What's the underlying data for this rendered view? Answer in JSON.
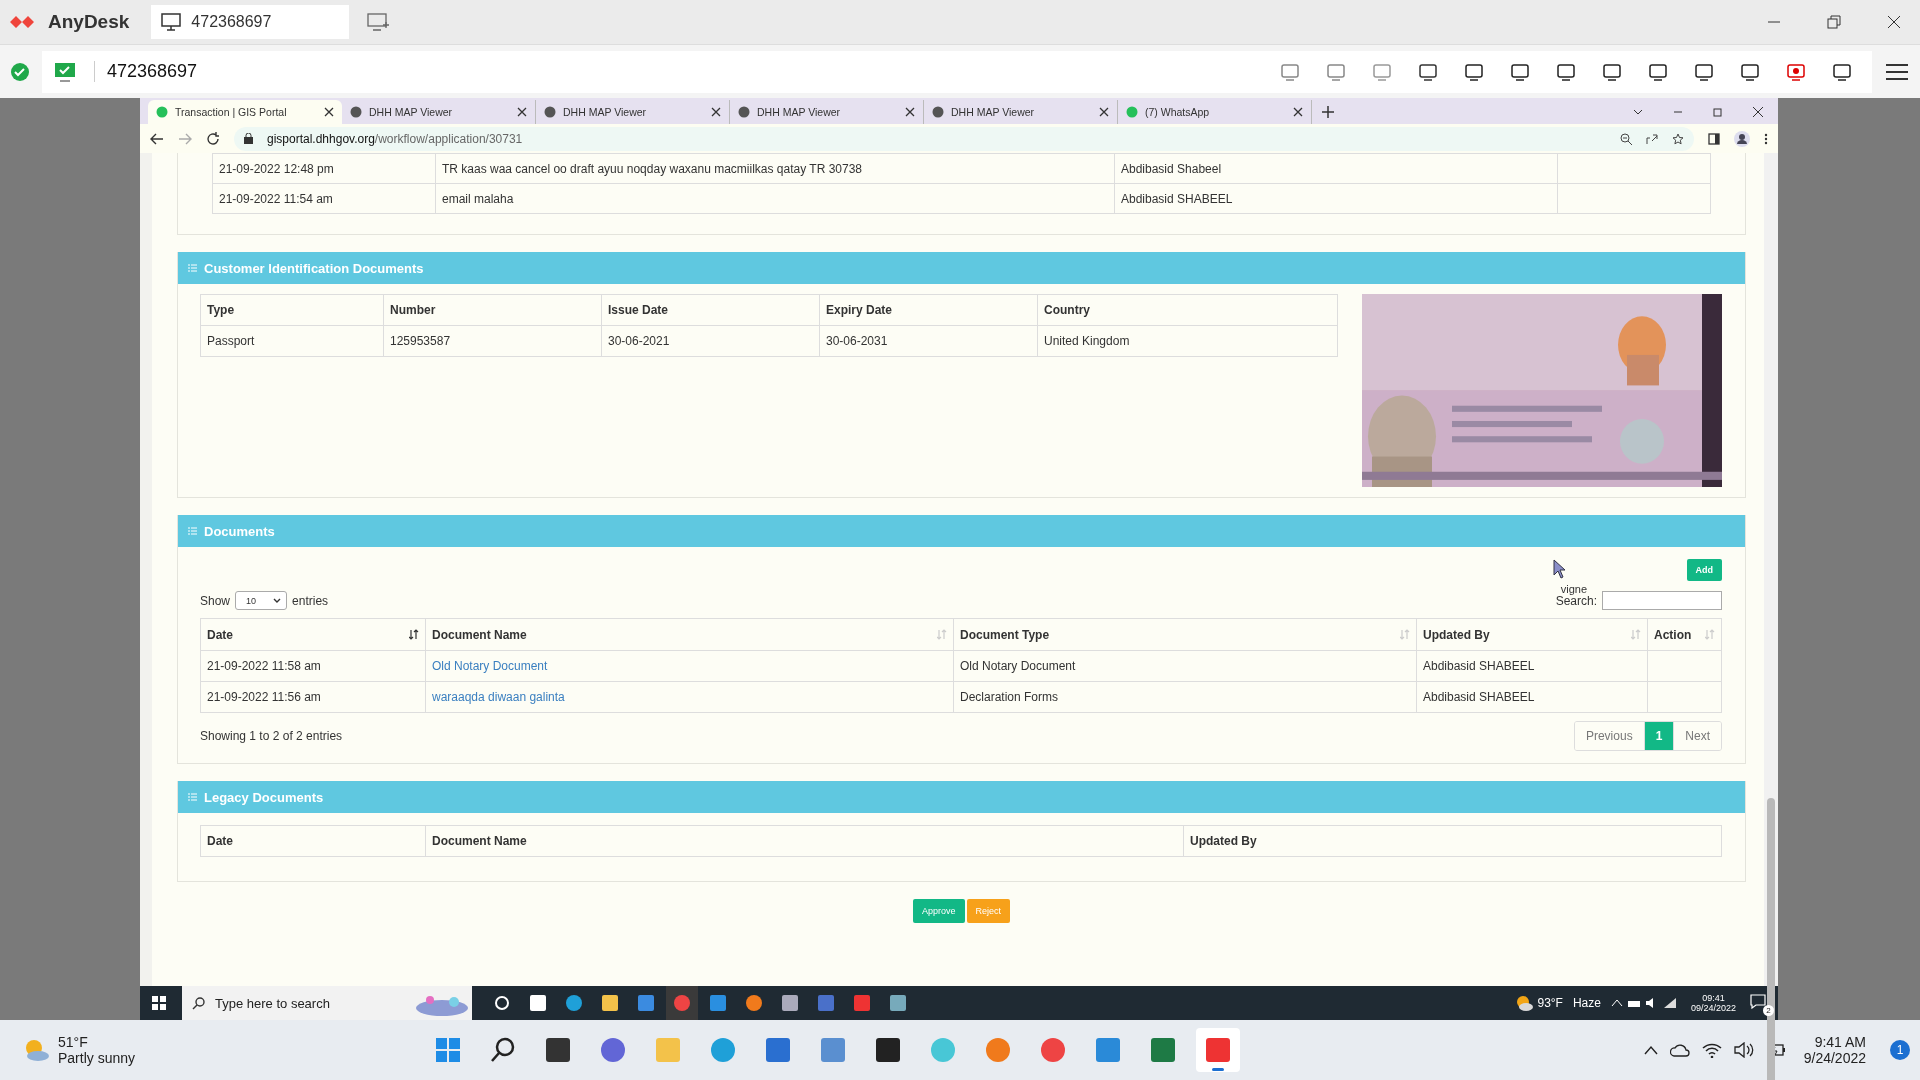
{
  "anydesk": {
    "app_name": "AnyDesk",
    "address": "472368697",
    "session_id": "472368697"
  },
  "browser": {
    "tabs": [
      {
        "title": "Transaction | GIS Portal",
        "selected": true,
        "kind": "portal"
      },
      {
        "title": "DHH MAP Viewer",
        "selected": false,
        "kind": "globe"
      },
      {
        "title": "DHH MAP Viewer",
        "selected": false,
        "kind": "globe"
      },
      {
        "title": "DHH MAP Viewer",
        "selected": false,
        "kind": "globe"
      },
      {
        "title": "DHH MAP Viewer",
        "selected": false,
        "kind": "globe"
      },
      {
        "title": "(7) WhatsApp",
        "selected": false,
        "kind": "whatsapp"
      }
    ],
    "url_host": "gisportal.dhhgov.org",
    "url_path": "/workflow/application/30731"
  },
  "history_rows": [
    {
      "date": "21-09-2022 12:48 pm",
      "comment": "TR kaas waa cancel oo draft ayuu noqday waxanu macmiilkas qatay TR 30738",
      "user": "Abdibasid Shabeel"
    },
    {
      "date": "21-09-2022 11:54 am",
      "comment": "email malaha",
      "user": "Abdibasid SHABEEL"
    }
  ],
  "customer_docs": {
    "title": "Customer Identification Documents",
    "columns": [
      "Type",
      "Number",
      "Issue Date",
      "Expiry Date",
      "Country"
    ],
    "rows": [
      [
        "Passport",
        "125953587",
        "30-06-2021",
        "30-06-2031",
        "United Kingdom"
      ]
    ]
  },
  "documents": {
    "title": "Documents",
    "add_button": "Add",
    "cursor_label": "vigne",
    "show_label": "Show",
    "entries_value": "10",
    "entries_label": "entries",
    "search_label": "Search:",
    "columns": [
      {
        "label": "Date",
        "sorted": true
      },
      {
        "label": "Document Name",
        "sorted": false
      },
      {
        "label": "Document Type",
        "sorted": false
      },
      {
        "label": "Updated By",
        "sorted": false
      },
      {
        "label": "Action",
        "sorted": false
      }
    ],
    "rows": [
      {
        "date": "21-09-2022 11:58 am",
        "name": "Old Notary Document",
        "type": "Old Notary Document",
        "user": "Abdibasid SHABEEL"
      },
      {
        "date": "21-09-2022 11:56 am",
        "name": "waraaqda diwaan galinta",
        "type": "Declaration Forms",
        "user": "Abdibasid SHABEEL"
      }
    ],
    "info": "Showing 1 to 2 of 2 entries",
    "pagination": [
      {
        "label": "Previous",
        "selected": false
      },
      {
        "label": "1",
        "selected": true
      },
      {
        "label": "Next",
        "selected": false
      }
    ]
  },
  "legacy": {
    "title": "Legacy Documents",
    "columns": [
      "Date",
      "Document Name",
      "Updated By"
    ]
  },
  "actions": [
    {
      "label": "Approve",
      "kind": "approve"
    },
    {
      "label": "Reject",
      "kind": "reject"
    }
  ],
  "remote_taskbar": {
    "placeholder": "Type here to search",
    "temperature": "93°F",
    "weather": "Haze",
    "time": "09:41",
    "date": "09/24/2022",
    "notification_count": "2"
  },
  "host_taskbar": {
    "temperature": "51°F",
    "weather": "Partly sunny",
    "time": "9:41 AM",
    "date": "9/24/2022",
    "notification_count": "1"
  }
}
